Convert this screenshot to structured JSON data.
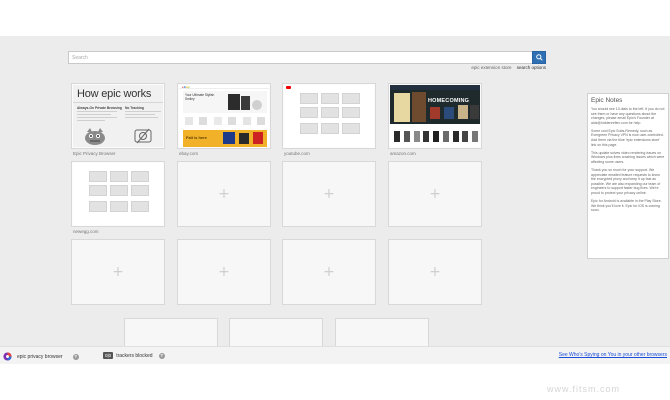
{
  "search": {
    "placeholder": "Search",
    "value": ""
  },
  "search_links": [
    {
      "label": "epic extension store"
    },
    {
      "label": "search options"
    }
  ],
  "tiles": {
    "epic_privacy_browser": {
      "label": "Epic Privacy Browser",
      "title": "How epic works",
      "col1": "Always-On Private Browsing",
      "col2": "No Tracking"
    },
    "ebay": {
      "label": "ebay.com",
      "headline": "Your Ultimate Stylish Smiley",
      "banner": "Fall is here"
    },
    "youtube": {
      "label": "youtube.com"
    },
    "amazon": {
      "label": "amazon.com",
      "banner_text": "HOMECOMING"
    },
    "newegg": {
      "label": "newegg.com"
    }
  },
  "empty_tile_symbol": "+",
  "epic_notes": {
    "title": "Epic Notes",
    "paragraphs": [
      "You should see 13 dials to the left. If you do not see them or have any questions about the changes, please email Epic's Founder at alok@hiddenreflex.com for help.",
      "Some cool Epic Subs-Remedy, such as Evergreen Privacy VPN is now user-controlled. Add them via the blue 'epic extensions store' link on this page.",
      "This update solves video rendering issues on Windows plus fixes crashing issues which were affecting some users.",
      "Thank you so much for your support. We appreciate emailed feature requests to know the encrypted proxy and keep it up fast as possible. We are also expanding our team of engineers to support faster bug fixes. We're proud to protect your privacy online.",
      "Epic for Android is available in the Play Store. We think you'll love it. Epic for iOS is coming soon."
    ]
  },
  "statusbar": {
    "brand_label": "epic privacy browser",
    "trackers_count": "0|0",
    "trackers_label": "trackers blocked",
    "help_symbol": "?",
    "spying_link": "See Who's Spying on You in your other browsers"
  },
  "watermark": "www.fitsm.com",
  "colors": {
    "accent": "#2f6fb3",
    "link": "#1a4ed8",
    "page_background": "#ececec"
  }
}
